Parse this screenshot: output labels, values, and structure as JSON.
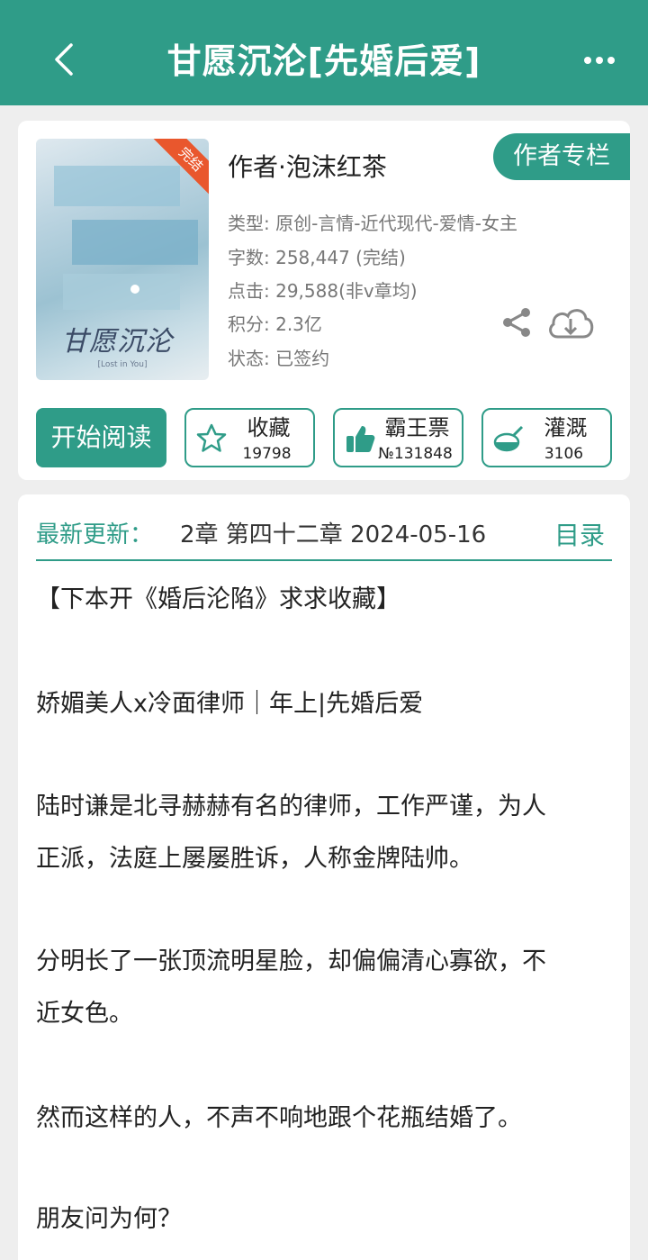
{
  "header": {
    "title": "甘愿沉沦[先婚后爱]",
    "back_icon": "chevron-left-icon",
    "more_icon": "more-dots-icon"
  },
  "book": {
    "cover_badge": "完结",
    "cover_title": "甘愿沉沦",
    "cover_subtitle": "[Lost in You]",
    "author": "作者·泡沫红茶",
    "author_column_label": "作者专栏",
    "type": "类型: 原创-言情-近代现代-爱情-女主",
    "word_count": "字数: 258,447 (完结)",
    "clicks": "点击: 29,588(非v章均)",
    "score": "积分: 2.3亿",
    "status": "状态: 已签约"
  },
  "actions": {
    "read_label": "开始阅读",
    "favorite": {
      "label": "收藏",
      "count": "19798"
    },
    "bawang": {
      "label": "霸王票",
      "count": "№131848"
    },
    "guangai": {
      "label": "灌溉",
      "count": "3106"
    }
  },
  "update": {
    "label": "最新更新：",
    "text": "2章  第四十二章  2024-05-16",
    "toc_label": "目录"
  },
  "description": [
    "【下本开《婚后沦陷》求求收藏】",
    "娇媚美人x冷面律师｜年上|先婚后爱",
    "陆时谦是北寻赫赫有名的律师，工作严谨，为人",
    "正派，法庭上屡屡胜诉，人称金牌陆帅。",
    "分明长了一张顶流明星脸，却偏偏清心寡欲，不",
    "近女色。",
    "然而这样的人，不声不响地跟个花瓶结婚了。",
    "朋友问为何？"
  ],
  "colors": {
    "accent": "#2f9c88",
    "badge": "#e9572d"
  }
}
